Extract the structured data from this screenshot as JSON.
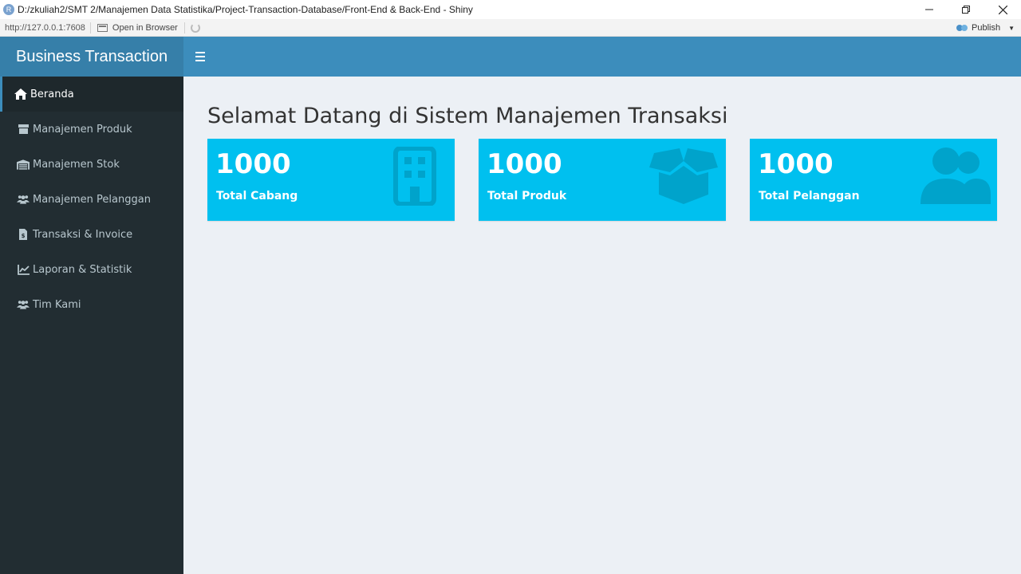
{
  "window": {
    "title": "D:/zkuliah2/SMT 2/Manajemen Data Statistika/Project-Transaction-Database/Front-End & Back-End - Shiny",
    "app_icon_letter": "R"
  },
  "toolbar": {
    "url": "http://127.0.0.1:7608",
    "open_browser_label": "Open in Browser",
    "publish_label": "Publish"
  },
  "header": {
    "logo_text": "Business Transaction"
  },
  "sidebar": {
    "items": [
      {
        "label": "Beranda",
        "icon": "home-icon"
      },
      {
        "label": "Manajemen Produk",
        "icon": "box-icon"
      },
      {
        "label": "Manajemen Stok",
        "icon": "warehouse-icon"
      },
      {
        "label": "Manajemen Pelanggan",
        "icon": "users-icon"
      },
      {
        "label": "Transaksi & Invoice",
        "icon": "invoice-icon"
      },
      {
        "label": "Laporan & Statistik",
        "icon": "line-chart-icon"
      },
      {
        "label": "Tim Kami",
        "icon": "team-icon"
      }
    ]
  },
  "main": {
    "title": "Selamat Datang di Sistem Manajemen Transaksi",
    "boxes": [
      {
        "value": "1000",
        "label": "Total Cabang",
        "icon": "building-icon"
      },
      {
        "value": "1000",
        "label": "Total Produk",
        "icon": "open-box-icon"
      },
      {
        "value": "1000",
        "label": "Total Pelanggan",
        "icon": "users-icon"
      }
    ]
  },
  "colors": {
    "header_logo_bg": "#367fa9",
    "navbar_bg": "#3c8dbc",
    "sidebar_bg": "#222d32",
    "content_bg": "#ecf0f5",
    "box_bg": "#00c0ef"
  }
}
